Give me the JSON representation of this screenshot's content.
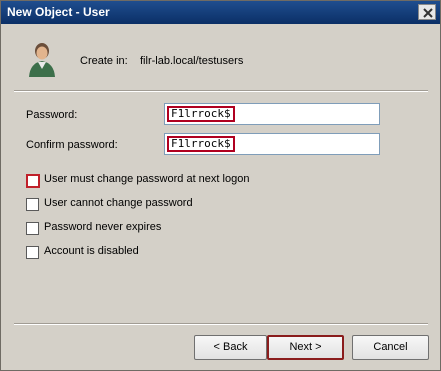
{
  "window": {
    "title": "New Object - User"
  },
  "header": {
    "create_in_label": "Create in:",
    "create_in_path": "filr-lab.local/testusers"
  },
  "form": {
    "password_label": "Password:",
    "password_value": "F1lrrock$",
    "confirm_label": "Confirm password:",
    "confirm_value": "F1lrrock$"
  },
  "options": [
    {
      "label": "User must change password at next logon",
      "checked": false
    },
    {
      "label": "User cannot change password",
      "checked": false
    },
    {
      "label": "Password never expires",
      "checked": false
    },
    {
      "label": "Account is disabled",
      "checked": false
    }
  ],
  "buttons": {
    "back": "< Back",
    "next": "Next >",
    "cancel": "Cancel"
  },
  "icons": {
    "close": "close-icon",
    "user": "user-icon"
  },
  "colors": {
    "title_bar": "#1f4e8f",
    "highlight": "#c0202a"
  }
}
